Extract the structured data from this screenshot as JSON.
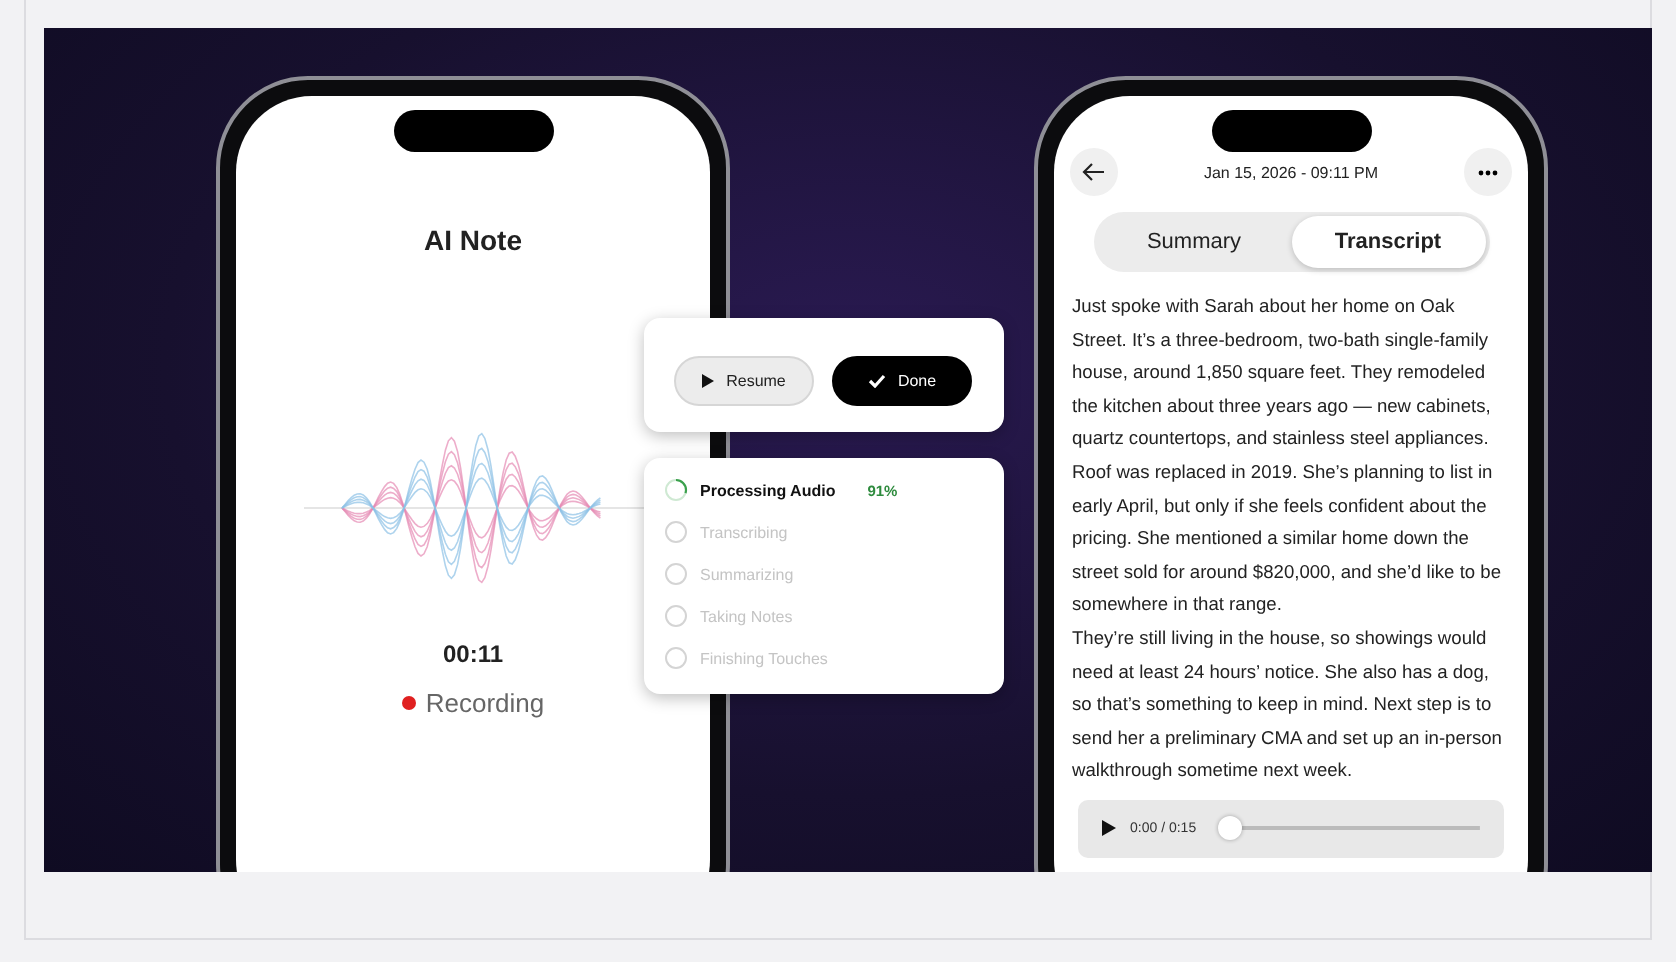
{
  "recorder": {
    "title": "AI Note",
    "timer": "00:11",
    "status": "Recording",
    "recording": true
  },
  "controls": {
    "resume": "Resume",
    "done": "Done"
  },
  "steps": [
    {
      "label": "Processing Audio",
      "active": true,
      "percent": "91%"
    },
    {
      "label": "Transcribing",
      "active": false
    },
    {
      "label": "Summarizing",
      "active": false
    },
    {
      "label": "Taking Notes",
      "active": false
    },
    {
      "label": "Finishing Touches",
      "active": false
    }
  ],
  "note": {
    "date": "Jan 15, 2026 - 09:11 PM",
    "tabs": [
      {
        "label": "Summary",
        "selected": false
      },
      {
        "label": "Transcript",
        "selected": true
      }
    ],
    "paragraphs": [
      "Just spoke with Sarah about her home on Oak Street. It’s a three-bedroom, two-bath single-family house, around 1,850 square feet. They remodeled the kitchen about three years ago — new cabinets, quartz countertops, and stainless steel appliances. Roof was replaced in 2019. She’s planning to list in early April, but only if she feels confident about the pricing. She mentioned a similar home down the street sold for around $820,000, and she’d like to be somewhere in that range.",
      "They’re still living in the house, so showings would need at least 24 hours’ notice. She also has a dog, so that’s something to keep in mind. Next step is to send her a preliminary CMA and set up an in-person walkthrough sometime next week."
    ],
    "player": {
      "time": "0:00 / 0:15",
      "level": 0
    }
  }
}
